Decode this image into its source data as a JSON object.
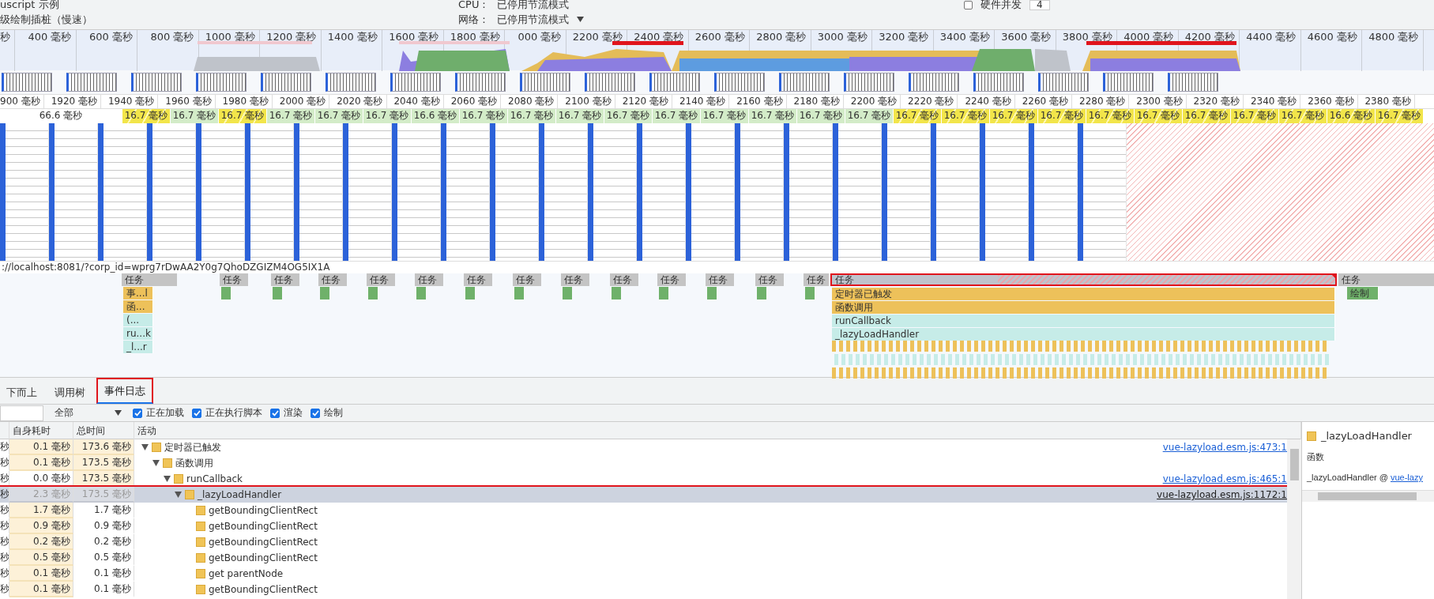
{
  "settings": {
    "top_left": "uscript 示例",
    "paint_instrumentation": "级绘制插桩（慢速）",
    "cpu_label": "CPU：",
    "cpu_value": "已停用节流模式",
    "network_label": "网络：",
    "network_value": "已停用节流模式",
    "hardware": {
      "label": "硬件并发",
      "checked": false,
      "value": "4"
    }
  },
  "overview": {
    "ticks": [
      "秒",
      "400 毫秒",
      "600 毫秒",
      "800 毫秒",
      "1000 毫秒",
      "1200 毫秒",
      "1400 毫秒",
      "1600 毫秒",
      "1800 毫秒",
      "000 毫秒",
      "2200 毫秒",
      "2400 毫秒",
      "2600 毫秒",
      "2800 毫秒",
      "3000 毫秒",
      "3200 毫秒",
      "3400 毫秒",
      "3600 毫秒",
      "3800 毫秒",
      "4000 毫秒",
      "4200 毫秒",
      "4400 毫秒",
      "4600 毫秒",
      "4800 毫秒"
    ]
  },
  "ruler": {
    "ticks": [
      "900 毫秒",
      "1920 毫秒",
      "1940 毫秒",
      "1960 毫秒",
      "1980 毫秒",
      "2000 毫秒",
      "2020 毫秒",
      "2040 毫秒",
      "2060 毫秒",
      "2080 毫秒",
      "2100 毫秒",
      "2120 毫秒",
      "2140 毫秒",
      "2160 毫秒",
      "2180 毫秒",
      "2200 毫秒",
      "2220 毫秒",
      "2240 毫秒",
      "2260 毫秒",
      "2280 毫秒",
      "2300 毫秒",
      "2320 毫秒",
      "2340 毫秒",
      "2360 毫秒",
      "2380 毫秒"
    ]
  },
  "frames": [
    {
      "label": "66.6 毫秒",
      "kind": "idle"
    },
    {
      "label": "16.7 毫秒",
      "kind": "partial"
    },
    {
      "label": "16.7 毫秒",
      "kind": "presented"
    },
    {
      "label": "16.7 毫秒",
      "kind": "partial"
    },
    {
      "label": "16.7 毫秒",
      "kind": "presented"
    },
    {
      "label": "16.7 毫秒",
      "kind": "presented"
    },
    {
      "label": "16.7 毫秒",
      "kind": "presented"
    },
    {
      "label": "16.6 毫秒",
      "kind": "presented"
    },
    {
      "label": "16.7 毫秒",
      "kind": "presented"
    },
    {
      "label": "16.7 毫秒",
      "kind": "presented"
    },
    {
      "label": "16.7 毫秒",
      "kind": "presented"
    },
    {
      "label": "16.7 毫秒",
      "kind": "presented"
    },
    {
      "label": "16.7 毫秒",
      "kind": "presented"
    },
    {
      "label": "16.7 毫秒",
      "kind": "presented"
    },
    {
      "label": "16.7 毫秒",
      "kind": "presented"
    },
    {
      "label": "16.7 毫秒",
      "kind": "presented"
    },
    {
      "label": "16.7 毫秒",
      "kind": "presented"
    },
    {
      "label": "16.7 毫秒",
      "kind": "partial"
    },
    {
      "label": "16.7 毫秒",
      "kind": "partial"
    },
    {
      "label": "16.7 毫秒",
      "kind": "partial"
    },
    {
      "label": "16.7 毫秒",
      "kind": "partial"
    },
    {
      "label": "16.7 毫秒",
      "kind": "partial"
    },
    {
      "label": "16.7 毫秒",
      "kind": "partial"
    },
    {
      "label": "16.7 毫秒",
      "kind": "partial"
    },
    {
      "label": "16.7 毫秒",
      "kind": "partial"
    },
    {
      "label": "16.7 毫秒",
      "kind": "partial"
    },
    {
      "label": "16.6 毫秒",
      "kind": "partial"
    },
    {
      "label": "16.7 毫秒",
      "kind": "partial"
    }
  ],
  "flame": {
    "url": "://localhost:8081/?corp_id=wprg7rDwAA2Y0g7QhoDZGIZM4OG5IX1A",
    "tasks": [
      {
        "label": "任务",
        "long": false,
        "children": [
          {
            "label": "事...l",
            "kind": "script",
            "children": [
              {
                "label": "函...",
                "kind": "script",
                "children": [
                  {
                    "label": "(...",
                    "kind": "function",
                    "children": [
                      {
                        "label": "ru...k",
                        "kind": "function",
                        "children": [
                          {
                            "label": "_l...r",
                            "kind": "function"
                          }
                        ]
                      }
                    ]
                  }
                ]
              }
            ]
          }
        ]
      },
      {
        "label": "任务",
        "long": false
      },
      {
        "label": "任务",
        "long": false
      },
      {
        "label": "任务",
        "long": false
      },
      {
        "label": "任务",
        "long": false
      },
      {
        "label": "任务",
        "long": false
      },
      {
        "label": "任务",
        "long": false
      },
      {
        "label": "任务",
        "long": false
      },
      {
        "label": "任务",
        "long": false
      },
      {
        "label": "任务",
        "long": false
      },
      {
        "label": "任务",
        "long": false
      },
      {
        "label": "任务",
        "long": false
      },
      {
        "label": "任务",
        "long": false
      },
      {
        "label": "任务",
        "long": false
      },
      {
        "label": "任务",
        "long": true,
        "children": [
          {
            "label": "定时器已触发",
            "kind": "script",
            "children": [
              {
                "label": "函数调用",
                "kind": "script",
                "children": [
                  {
                    "label": "runCallback",
                    "kind": "function",
                    "children": [
                      {
                        "label": "_lazyLoadHandler",
                        "kind": "function"
                      }
                    ]
                  }
                ]
              }
            ]
          }
        ]
      },
      {
        "label": "任务",
        "long": false,
        "children": [
          {
            "label": "绘制",
            "kind": "paint"
          }
        ]
      }
    ]
  },
  "tabs": [
    {
      "label": "下而上",
      "selected": false,
      "outlined": false
    },
    {
      "label": "调用树",
      "selected": false,
      "outlined": false
    },
    {
      "label": "事件日志",
      "selected": true,
      "outlined": true
    }
  ],
  "filter": {
    "dropdown": "全部",
    "checkboxes": [
      {
        "label": "正在加载",
        "checked": true
      },
      {
        "label": "正在执行脚本",
        "checked": true
      },
      {
        "label": "渲染",
        "checked": true
      },
      {
        "label": "绘制",
        "checked": true
      }
    ]
  },
  "table": {
    "columns": [
      "自身耗时",
      "总时间",
      "活动"
    ],
    "rows": [
      {
        "column_1": "秒",
        "self": "0.1 毫秒",
        "total": "173.6 毫秒",
        "name": "定时器已触发",
        "link": "vue-lazyload.esm.js:473:1",
        "expanded": true,
        "selected": false,
        "outlined": false,
        "self_heat": true,
        "total_heat": true,
        "children": [
          {
            "column_1": "秒",
            "self": "0.1 毫秒",
            "total": "173.5 毫秒",
            "name": "函数调用",
            "expanded": true,
            "selected": false,
            "outlined": false,
            "self_heat": true,
            "total_heat": true,
            "children": [
              {
                "column_1": "秒",
                "self": "0.0 毫秒",
                "total": "173.5 毫秒",
                "name": "runCallback",
                "link": "vue-lazyload.esm.js:465:1",
                "expanded": true,
                "selected": false,
                "outlined": false,
                "self_heat": false,
                "total_heat": true,
                "children": [
                  {
                    "column_1": "秒",
                    "self": "2.3 毫秒",
                    "total": "173.5 毫秒",
                    "name": "_lazyLoadHandler",
                    "link": "vue-lazyload.esm.js:1172:1",
                    "expanded": true,
                    "selected": true,
                    "outlined": true,
                    "self_heat": true,
                    "total_heat": true,
                    "children": [
                      {
                        "column_1": "秒",
                        "self": "1.7 毫秒",
                        "total": "1.7 毫秒",
                        "name": "getBoundingClientRect",
                        "selected": false,
                        "outlined": false,
                        "self_heat": true,
                        "total_heat": false
                      },
                      {
                        "column_1": "秒",
                        "self": "0.9 毫秒",
                        "total": "0.9 毫秒",
                        "name": "getBoundingClientRect",
                        "selected": false,
                        "outlined": false,
                        "self_heat": true,
                        "total_heat": false
                      },
                      {
                        "column_1": "秒",
                        "self": "0.2 毫秒",
                        "total": "0.2 毫秒",
                        "name": "getBoundingClientRect",
                        "selected": false,
                        "outlined": false,
                        "self_heat": true,
                        "total_heat": false
                      },
                      {
                        "column_1": "秒",
                        "self": "0.5 毫秒",
                        "total": "0.5 毫秒",
                        "name": "getBoundingClientRect",
                        "selected": false,
                        "outlined": false,
                        "self_heat": true,
                        "total_heat": false
                      },
                      {
                        "column_1": "秒",
                        "self": "0.1 毫秒",
                        "total": "0.1 毫秒",
                        "name": "get parentNode",
                        "selected": false,
                        "outlined": false,
                        "self_heat": true,
                        "total_heat": false
                      },
                      {
                        "column_1": "秒",
                        "self": "0.1 毫秒",
                        "total": "0.1 毫秒",
                        "name": "getBoundingClientRect",
                        "selected": false,
                        "outlined": false,
                        "self_heat": true,
                        "total_heat": false
                      }
                    ]
                  }
                ]
              }
            ]
          }
        ]
      }
    ]
  },
  "details": {
    "title": "_lazyLoadHandler",
    "category": "函数",
    "source_prefix": "_lazyLoadHandler @ ",
    "source_link": "vue-lazy"
  }
}
